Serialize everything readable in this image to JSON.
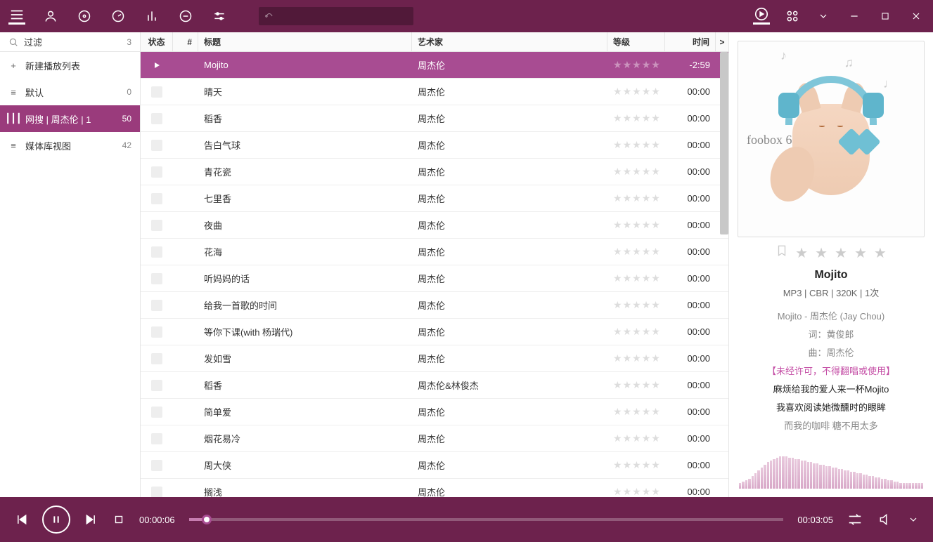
{
  "titlebar": {
    "icons": [
      "playlist-icon",
      "user-icon",
      "disc-icon",
      "speed-icon",
      "equalizer-icon",
      "repeat-icon",
      "settings-icon"
    ],
    "right_icons": [
      "now-playing-icon",
      "apps-icon",
      "dropdown-icon",
      "minimize-icon",
      "maximize-icon",
      "close-icon"
    ]
  },
  "sidebar": {
    "filter_label": "过滤",
    "filter_count": "3",
    "items": [
      {
        "icon": "plus",
        "label": "新建播放列表",
        "count": ""
      },
      {
        "icon": "list",
        "label": "默认",
        "count": "0"
      },
      {
        "icon": "bars",
        "label": "网搜 | 周杰伦 | 1",
        "count": "50",
        "selected": true
      },
      {
        "icon": "list",
        "label": "媒体库视图",
        "count": "42"
      }
    ]
  },
  "columns": {
    "status": "状态",
    "num": "#",
    "title": "标题",
    "artist": "艺术家",
    "rating": "等级",
    "time": "时间",
    "more": ">"
  },
  "tracks": [
    {
      "title": "Mojito",
      "artist": "周杰伦",
      "time": "-2:59",
      "playing": true
    },
    {
      "title": "晴天",
      "artist": "周杰伦",
      "time": "00:00"
    },
    {
      "title": "稻香",
      "artist": "周杰伦",
      "time": "00:00"
    },
    {
      "title": "告白气球",
      "artist": "周杰伦",
      "time": "00:00"
    },
    {
      "title": "青花瓷",
      "artist": "周杰伦",
      "time": "00:00"
    },
    {
      "title": "七里香",
      "artist": "周杰伦",
      "time": "00:00"
    },
    {
      "title": "夜曲",
      "artist": "周杰伦",
      "time": "00:00"
    },
    {
      "title": "花海",
      "artist": "周杰伦",
      "time": "00:00"
    },
    {
      "title": "听妈妈的话",
      "artist": "周杰伦",
      "time": "00:00"
    },
    {
      "title": "给我一首歌的时间",
      "artist": "周杰伦",
      "time": "00:00"
    },
    {
      "title": "等你下课(with 杨瑞代)",
      "artist": "周杰伦",
      "time": "00:00"
    },
    {
      "title": "发如雪",
      "artist": "周杰伦",
      "time": "00:00"
    },
    {
      "title": "稻香",
      "artist": "周杰伦&林俊杰",
      "time": "00:00"
    },
    {
      "title": "简单爱",
      "artist": "周杰伦",
      "time": "00:00"
    },
    {
      "title": "烟花易冷",
      "artist": "周杰伦",
      "time": "00:00"
    },
    {
      "title": "周大侠",
      "artist": "周杰伦",
      "time": "00:00"
    },
    {
      "title": "搁浅",
      "artist": "周杰伦",
      "time": "00:00"
    }
  ],
  "nowplaying": {
    "cover_text": "foobox 6",
    "title": "Mojito",
    "meta": "MP3 | CBR | 320K | 1次",
    "lyrics": [
      {
        "text": "Mojito - 周杰伦 (Jay Chou)",
        "cls": ""
      },
      {
        "text": "词：黄俊郎",
        "cls": ""
      },
      {
        "text": "曲：周杰伦",
        "cls": ""
      },
      {
        "text": "【未经许可，不得翻唱或使用】",
        "cls": "warn"
      },
      {
        "text": "麻烦给我的爱人来一杯Mojito",
        "cls": "active"
      },
      {
        "text": "我喜欢阅读她微醺时的眼眸",
        "cls": "active"
      },
      {
        "text": "而我的咖啡 糖不用太多",
        "cls": ""
      }
    ]
  },
  "player": {
    "elapsed": "00:00:06",
    "total": "00:03:05"
  },
  "spectrum": [
    8,
    10,
    12,
    14,
    18,
    22,
    26,
    30,
    34,
    38,
    40,
    42,
    44,
    46,
    46,
    46,
    44,
    44,
    42,
    42,
    40,
    40,
    38,
    38,
    36,
    36,
    34,
    34,
    32,
    32,
    30,
    30,
    28,
    28,
    26,
    26,
    24,
    24,
    22,
    22,
    20,
    20,
    18,
    18,
    16,
    16,
    14,
    14,
    12,
    12,
    10,
    10,
    8,
    8,
    8,
    8,
    8,
    8,
    8,
    8
  ]
}
